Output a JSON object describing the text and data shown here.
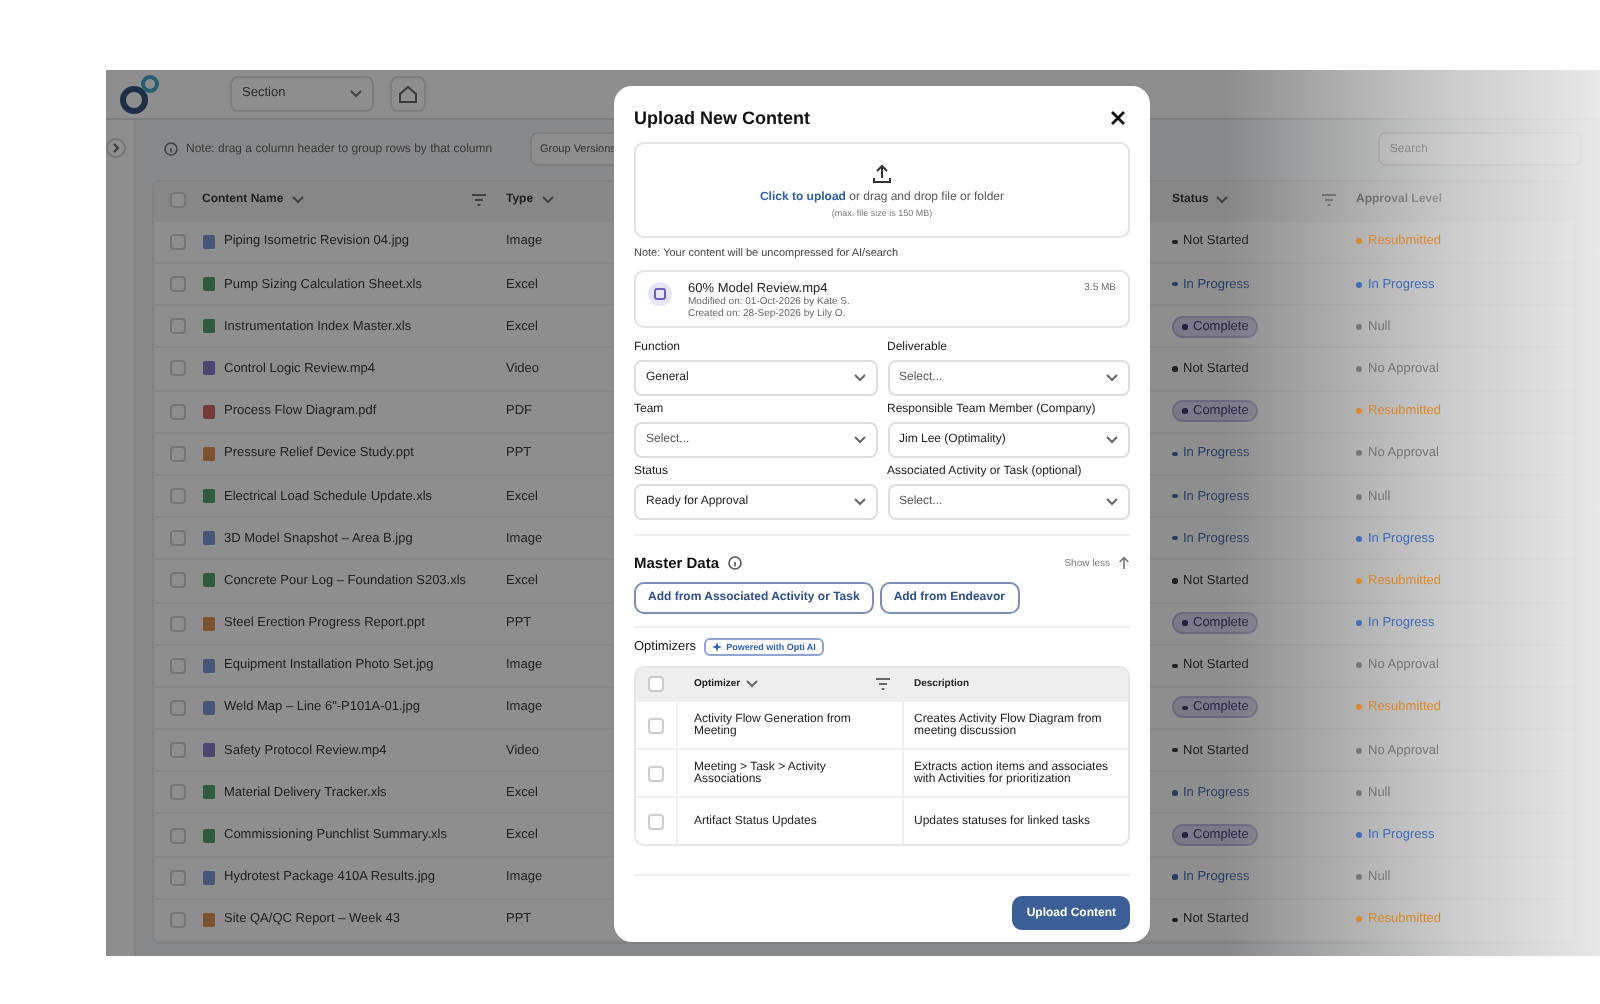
{
  "top_bar": {
    "section_dropdown": {
      "value": "Section"
    }
  },
  "toolbar": {
    "note": "Note: drag a column header to group rows by that column",
    "group_button": "Group Versions",
    "search": {
      "placeholder": "Search"
    }
  },
  "table": {
    "all_checked": false,
    "columns": [
      "Content Name",
      "Type",
      "Status",
      "Approval Level"
    ],
    "rows": [
      {
        "checked": false,
        "name": "Piping Isometric Revision 04.jpg",
        "kind": "image",
        "type": "Image",
        "status": {
          "label": "Not Started",
          "kind": "neutral"
        },
        "approval": {
          "label": "Resubmitted",
          "color": "#d98a2b"
        }
      },
      {
        "checked": false,
        "name": "Pump Sizing Calculation Sheet.xls",
        "kind": "sheet",
        "type": "Excel",
        "status": {
          "label": "In Progress",
          "kind": "active"
        },
        "approval": {
          "label": "In Progress",
          "color": "#3f6db8"
        }
      },
      {
        "checked": false,
        "name": "Instrumentation Index Master.xls",
        "kind": "sheet",
        "type": "Excel",
        "status": {
          "label": "Complete",
          "kind": "done"
        },
        "approval": {
          "label": "Null",
          "color": "#777777"
        }
      },
      {
        "checked": false,
        "name": "Control Logic Review.mp4",
        "kind": "video",
        "type": "Video",
        "status": {
          "label": "Not Started",
          "kind": "neutral"
        },
        "approval": {
          "label": "No Approval",
          "color": "#777777"
        }
      },
      {
        "checked": false,
        "name": "Process Flow Diagram.pdf",
        "kind": "pdf",
        "type": "PDF",
        "status": {
          "label": "Complete",
          "kind": "done"
        },
        "approval": {
          "label": "Resubmitted",
          "color": "#d98a2b"
        }
      },
      {
        "checked": false,
        "name": "Pressure Relief Device Study.ppt",
        "kind": "slides",
        "type": "PPT",
        "status": {
          "label": "In Progress",
          "kind": "active"
        },
        "approval": {
          "label": "No Approval",
          "color": "#777777"
        }
      },
      {
        "checked": false,
        "name": "Electrical Load Schedule Update.xls",
        "kind": "sheet",
        "type": "Excel",
        "status": {
          "label": "In Progress",
          "kind": "active"
        },
        "approval": {
          "label": "Null",
          "color": "#777777"
        }
      },
      {
        "checked": false,
        "name": "3D Model Snapshot – Area B.jpg",
        "kind": "image",
        "type": "Image",
        "status": {
          "label": "In Progress",
          "kind": "active"
        },
        "approval": {
          "label": "In Progress",
          "color": "#3f6db8"
        }
      },
      {
        "checked": false,
        "name": "Concrete Pour Log – Foundation S203.xls",
        "kind": "sheet",
        "type": "Excel",
        "status": {
          "label": "Not Started",
          "kind": "neutral"
        },
        "approval": {
          "label": "Resubmitted",
          "color": "#d98a2b"
        }
      },
      {
        "checked": false,
        "name": "Steel Erection Progress Report.ppt",
        "kind": "slides",
        "type": "PPT",
        "status": {
          "label": "Complete",
          "kind": "done"
        },
        "approval": {
          "label": "In Progress",
          "color": "#3f6db8"
        }
      },
      {
        "checked": false,
        "name": "Equipment Installation Photo Set.jpg",
        "kind": "image",
        "type": "Image",
        "status": {
          "label": "Not Started",
          "kind": "neutral"
        },
        "approval": {
          "label": "No Approval",
          "color": "#777777"
        }
      },
      {
        "checked": false,
        "name": "Weld Map – Line 6\"-P101A-01.jpg",
        "kind": "image",
        "type": "Image",
        "status": {
          "label": "Complete",
          "kind": "done"
        },
        "approval": {
          "label": "Resubmitted",
          "color": "#d98a2b"
        }
      },
      {
        "checked": false,
        "name": "Safety Protocol Review.mp4",
        "kind": "video",
        "type": "Video",
        "status": {
          "label": "Not Started",
          "kind": "neutral"
        },
        "approval": {
          "label": "No Approval",
          "color": "#777777"
        }
      },
      {
        "checked": false,
        "name": "Material Delivery Tracker.xls",
        "kind": "sheet",
        "type": "Excel",
        "status": {
          "label": "In Progress",
          "kind": "active"
        },
        "approval": {
          "label": "Null",
          "color": "#777777"
        }
      },
      {
        "checked": false,
        "name": "Commissioning Punchlist Summary.xls",
        "kind": "sheet",
        "type": "Excel",
        "status": {
          "label": "Complete",
          "kind": "done"
        },
        "approval": {
          "label": "In Progress",
          "color": "#3f6db8"
        }
      },
      {
        "checked": false,
        "name": "Hydrotest Package 410A Results.jpg",
        "kind": "image",
        "type": "Image",
        "status": {
          "label": "In Progress",
          "kind": "active"
        },
        "approval": {
          "label": "Null",
          "color": "#777777"
        }
      },
      {
        "checked": false,
        "name": "Site QA/QC Report – Week 43",
        "kind": "slides",
        "type": "PPT",
        "status": {
          "label": "Not Started",
          "kind": "neutral"
        },
        "approval": {
          "label": "Resubmitted",
          "color": "#d98a2b"
        }
      }
    ]
  },
  "dialog": {
    "title": "Upload New Content",
    "dropzone": {
      "link": "Click to upload",
      "text": "or drag and drop file or folder",
      "limit": "(max. file size is 150 MB)"
    },
    "note": "Note: Your content will be uncompressed for AI/search",
    "file": {
      "name": "60% Model Review.mp4",
      "modified": "Modified on: 01-Oct-2026 by Kate S.",
      "created": "Created on:  28-Sep-2026 by Lily O.",
      "size": "3.5 MB"
    },
    "fields": [
      {
        "label": "Function",
        "value": "General"
      },
      {
        "label": "Deliverable",
        "placeholder": "Select..."
      },
      {
        "label": "Team",
        "placeholder": "Select..."
      },
      {
        "label": "Responsible Team Member (Company)",
        "value": "Jim Lee (Optimality)"
      },
      {
        "label": "Status",
        "value": "Ready for Approval"
      },
      {
        "label": "Associated Activity or Task (optional)",
        "placeholder": "Select..."
      }
    ],
    "master_data": {
      "title": "Master Data",
      "toggle": "Show less",
      "buttons": [
        "Add from Associated Activity or Task",
        "Add from Endeavor"
      ]
    },
    "optimizers": {
      "all_checked": false,
      "title": "Optimizers",
      "badge": "Powered with Opti AI",
      "columns": [
        "Optimizer",
        "Description"
      ],
      "rows": [
        {
          "name": "Activity Flow Generation from Meeting",
          "description": "Creates Activity Flow Diagram from meeting discussion",
          "checked": false
        },
        {
          "name": "Meeting > Task > Activity Associations",
          "description": "Extracts action items and associates with Activities for prioritization",
          "checked": false
        },
        {
          "name": "Artifact Status Updates",
          "description": "Updates statuses for linked tasks",
          "checked": false
        }
      ]
    },
    "submit": "Upload Content"
  }
}
